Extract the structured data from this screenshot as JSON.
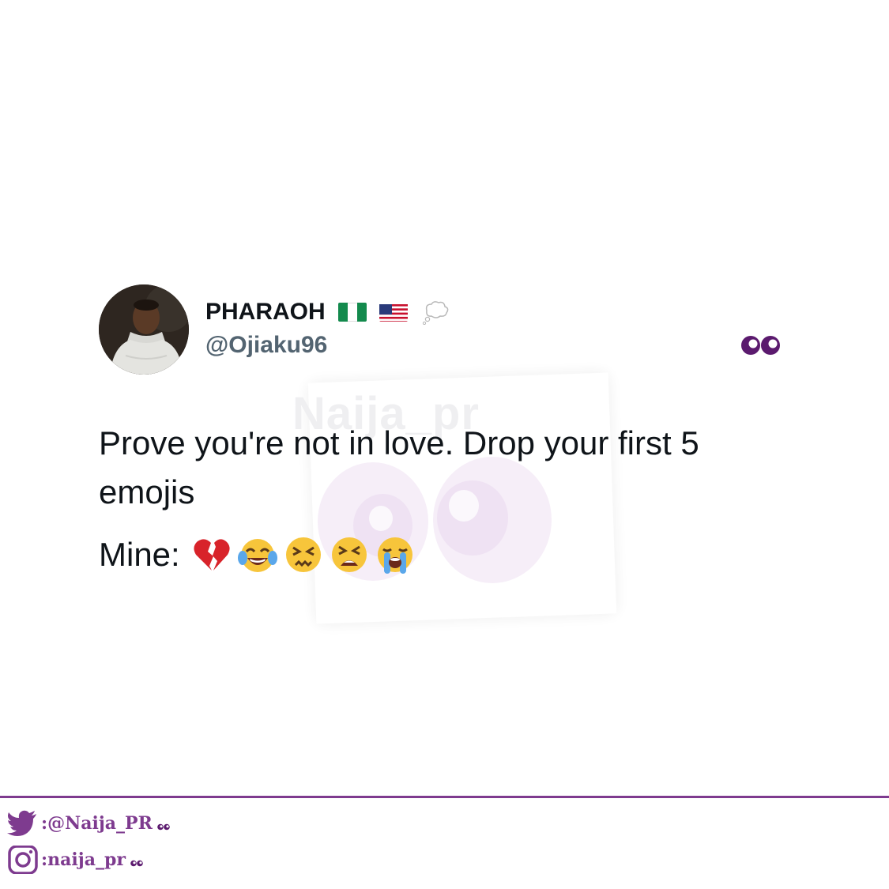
{
  "watermark": {
    "text": "Naija_pr"
  },
  "tweet": {
    "display_name": "PHARAOH",
    "name_badges": [
      "nigeria-flag",
      "usa-flag",
      "thought-balloon"
    ],
    "handle": "@Ojiaku96",
    "text": "Prove you're not in love. Drop your first 5 emojis",
    "mine_label": "Mine:",
    "mine_emojis": [
      "broken-heart",
      "face-with-tears-of-joy",
      "confounded-face",
      "tired-face",
      "loudly-crying-face"
    ]
  },
  "footer": {
    "twitter_handle": ":@Naija_PR",
    "instagram_handle": ":naija_pr",
    "accent_color": "#7e3b8f"
  }
}
